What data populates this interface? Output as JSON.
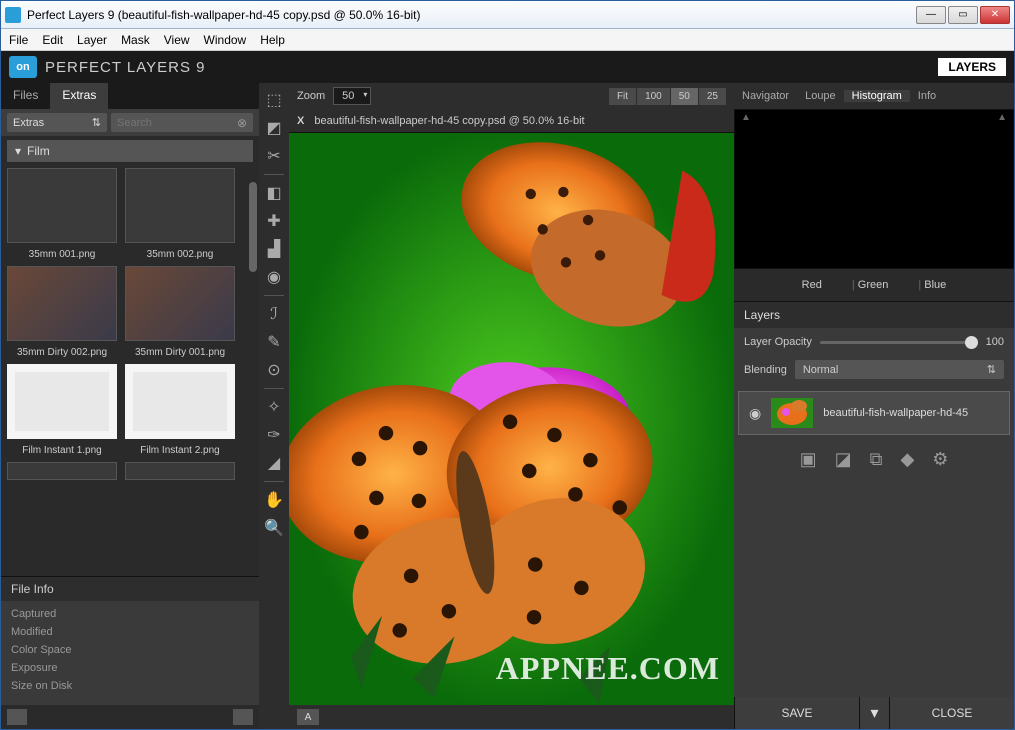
{
  "window": {
    "title": "Perfect Layers 9 (beautiful-fish-wallpaper-hd-45 copy.psd @ 50.0% 16-bit)"
  },
  "menu": [
    "File",
    "Edit",
    "Layer",
    "Mask",
    "View",
    "Window",
    "Help"
  ],
  "brand": {
    "logo": "on",
    "name": "PERFECT LAYERS 9",
    "layers_btn": "LAYERS"
  },
  "left": {
    "tabs": [
      "Files",
      "Extras"
    ],
    "active_tab": 1,
    "dropdown": "Extras",
    "search_placeholder": "Search",
    "section": "Film",
    "thumbs": [
      "35mm 001.png",
      "35mm 002.png",
      "35mm Dirty 002.png",
      "35mm Dirty  001.png",
      "Film Instant 1.png",
      "Film Instant 2.png"
    ],
    "file_info": {
      "header": "File Info",
      "rows": [
        "Captured",
        "Modified",
        "Color Space",
        "Exposure",
        "Size on Disk"
      ]
    }
  },
  "center": {
    "zoom_label": "Zoom",
    "zoom_value": "50",
    "fit_buttons": [
      "Fit",
      "100",
      "50",
      "25"
    ],
    "active_fit": 2,
    "doc_name": "beautiful-fish-wallpaper-hd-45 copy.psd @ 50.0% 16-bit",
    "ab_label": "A"
  },
  "right": {
    "tabs": [
      "Navigator",
      "Loupe",
      "Histogram",
      "Info"
    ],
    "active_tab": 2,
    "channels": [
      "Red",
      "Green",
      "Blue"
    ],
    "layers_header": "Layers",
    "opacity_label": "Layer Opacity",
    "opacity_value": "100",
    "blend_label": "Blending",
    "blend_value": "Normal",
    "layer_name": "beautiful-fish-wallpaper-hd-45",
    "save": "SAVE",
    "close": "CLOSE"
  },
  "watermark": "APPNEE.COM"
}
